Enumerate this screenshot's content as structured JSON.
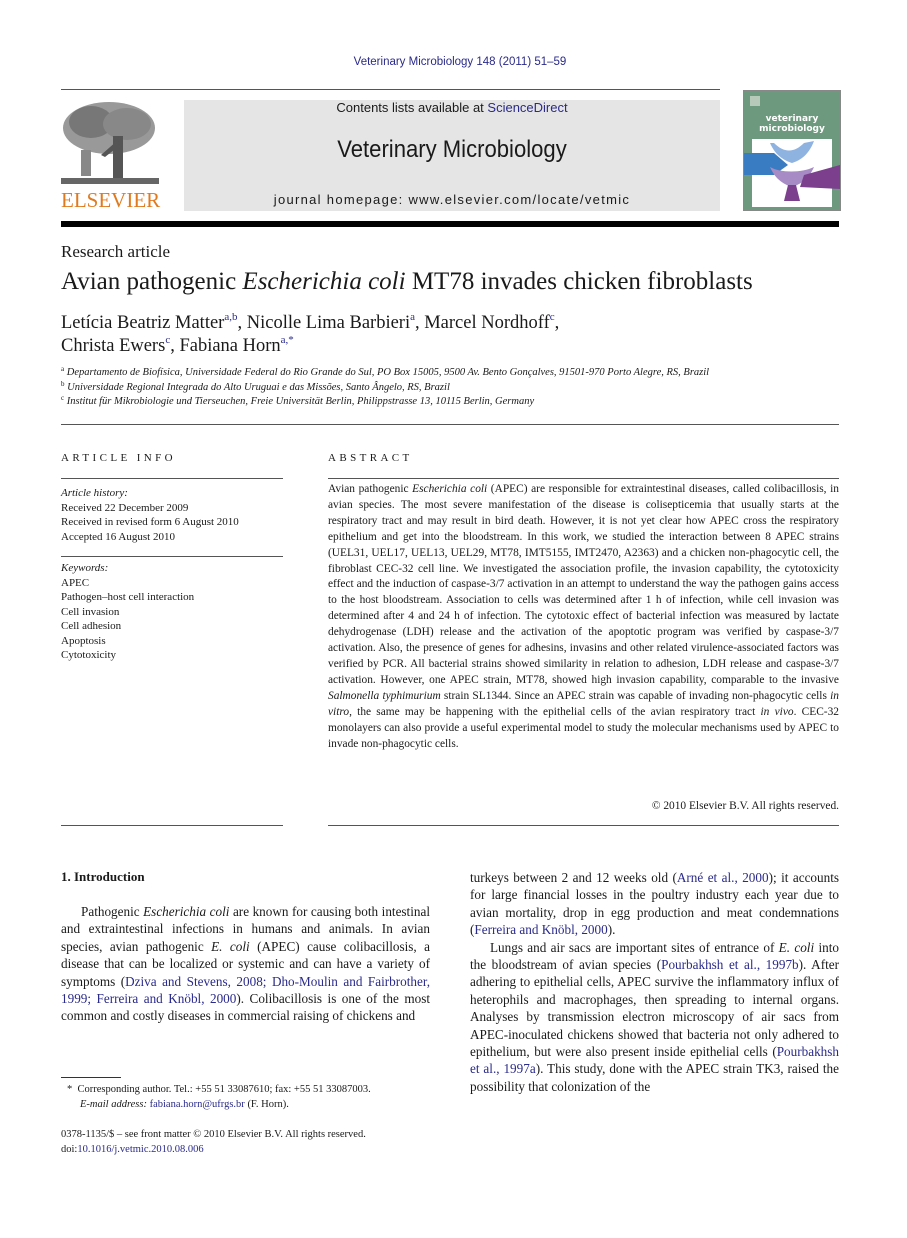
{
  "header": {
    "journal_citation": "Veterinary Microbiology 148 (2011) 51–59",
    "contents_prefix": "Contents lists available at ",
    "contents_link": "ScienceDirect",
    "journal_title": "Veterinary Microbiology",
    "homepage": "journal homepage: www.elsevier.com/locate/vetmic",
    "publisher_logo_word": "ELSEVIER",
    "cover": {
      "line1": "veterinary",
      "line2": "microbiology",
      "colors": {
        "background": "#6d9a7e",
        "blue": "#8fb3e0",
        "purple": "#7b3f8e",
        "lilac": "#a68bc4",
        "deep_blue": "#3a7cc2"
      }
    }
  },
  "article": {
    "type": "Research article",
    "title_pre": "Avian pathogenic ",
    "title_italic": "Escherichia coli",
    "title_post": " MT78 invades chicken fibroblasts",
    "authors": [
      {
        "name": "Letícia Beatriz Matter",
        "aff": "a,b",
        "sep": ", "
      },
      {
        "name": "Nicolle Lima Barbieri",
        "aff": "a",
        "sep": ", "
      },
      {
        "name": "Marcel Nordhoff",
        "aff": "c",
        "sep": ","
      },
      {
        "name": "Christa Ewers",
        "aff": "c",
        "sep": ", "
      },
      {
        "name": "Fabiana Horn",
        "aff": "a,*",
        "sep": ""
      }
    ],
    "affiliations": [
      {
        "key": "a",
        "text": "Departamento de Biofísica, Universidade Federal do Rio Grande do Sul, PO Box 15005, 9500 Av. Bento Gonçalves, 91501-970 Porto Alegre, RS, Brazil"
      },
      {
        "key": "b",
        "text": "Universidade Regional Integrada do Alto Uruguai e das Missões, Santo Ângelo, RS, Brazil"
      },
      {
        "key": "c",
        "text": "Institut für Mikrobiologie und Tierseuchen, Freie Universität Berlin, Philippstrasse 13, 10115 Berlin, Germany"
      }
    ]
  },
  "article_info": {
    "heading": "ARTICLE INFO",
    "history_label": "Article history:",
    "history": [
      "Received 22 December 2009",
      "Received in revised form 6 August 2010",
      "Accepted 16 August 2010"
    ],
    "keywords_label": "Keywords:",
    "keywords": [
      "APEC",
      "Pathogen–host cell interaction",
      "Cell invasion",
      "Cell adhesion",
      "Apoptosis",
      "Cytotoxicity"
    ]
  },
  "abstract": {
    "heading": "ABSTRACT",
    "p1_a": "Avian pathogenic ",
    "p1_i1": "Escherichia coli",
    "p1_b": " (APEC) are responsible for extraintestinal diseases, called colibacillosis, in avian species. The most severe manifestation of the disease is colisepticemia that usually starts at the respiratory tract and may result in bird death. However, it is not yet clear how APEC cross the respiratory epithelium and get into the bloodstream. In this work, we studied the interaction between 8 APEC strains (UEL31, UEL17, UEL13, UEL29, MT78, IMT5155, IMT2470, A2363) and a chicken non-phagocytic cell, the fibroblast CEC-32 cell line. We investigated the association profile, the invasion capability, the cytotoxicity effect and the induction of caspase-3/7 activation in an attempt to understand the way the pathogen gains access to the host bloodstream. Association to cells was determined after 1 h of infection, while cell invasion was determined after 4 and 24 h of infection. The cytotoxic effect of bacterial infection was measured by lactate dehydrogenase (LDH) release and the activation of the apoptotic program was verified by caspase-3/7 activation. Also, the presence of genes for adhesins, invasins and other related virulence-associated factors was verified by PCR. All bacterial strains showed similarity in relation to adhesion, LDH release and caspase-3/7 activation. However, one APEC strain, MT78, showed high invasion capability, comparable to the invasive ",
    "p1_i2": "Salmonella typhimurium",
    "p1_c": " strain SL1344. Since an APEC strain was capable of invading non-phagocytic cells ",
    "p1_i3": "in vitro",
    "p1_d": ", the same may be happening with the epithelial cells of the avian respiratory tract ",
    "p1_i4": "in vivo",
    "p1_e": ". CEC-32 monolayers can also provide a useful experimental model to study the molecular mechanisms used by APEC to invade non-phagocytic cells.",
    "copyright": "© 2010 Elsevier B.V. All rights reserved."
  },
  "introduction": {
    "heading": "1.  Introduction",
    "left_a": "Pathogenic ",
    "left_i1": "Escherichia coli",
    "left_b": " are known for causing both intestinal and extraintestinal infections in humans and animals. In avian species, avian pathogenic ",
    "left_i2": "E. coli",
    "left_c": " (APEC) cause colibacillosis, a disease that can be localized or systemic and can have a variety of symptoms (",
    "left_ref1": "Dziva and Stevens, 2008; Dho-Moulin and Fairbrother, 1999; Ferreira and Knöbl, 2000",
    "left_d": "). Colibacillosis is one of the most common and costly diseases in commercial raising of chickens and",
    "right_a": "turkeys between 2 and 12 weeks old (",
    "right_ref1": "Arné et al., 2000",
    "right_b": "); it accounts for large financial losses in the poultry industry each year due to avian mortality, drop in egg production and meat condemnations (",
    "right_ref2": "Ferreira and Knöbl, 2000",
    "right_c": ").",
    "right_p2_a": "Lungs and air sacs are important sites of entrance of ",
    "right_p2_i1": "E. coli",
    "right_p2_b": " into the bloodstream of avian species (",
    "right_p2_ref1": "Pourbakhsh et al., 1997b",
    "right_p2_c": "). After adhering to epithelial cells, APEC survive the inflammatory influx of heterophils and macrophages, then spreading to internal organs. Analyses by transmission electron microscopy of air sacs from APEC-inoculated chickens showed that bacteria not only adhered to epithelium, but were also present inside epithelial cells (",
    "right_p2_ref2": "Pourbakhsh et al., 1997a",
    "right_p2_d": "). This study, done with the APEC strain TK3, raised the possibility that colonization of the"
  },
  "footnotes": {
    "corresponding": "Corresponding author. Tel.: +55 51 33087610; fax: +55 51 33087003.",
    "star": "*",
    "email_label": "E-mail address: ",
    "email": "fabiana.horn@ufrgs.br",
    "email_suffix": " (F. Horn).",
    "front_matter": "0378-1135/$ – see front matter © 2010 Elsevier B.V. All rights reserved.",
    "doi_label": "doi:",
    "doi": "10.1016/j.vetmic.2010.08.006"
  }
}
